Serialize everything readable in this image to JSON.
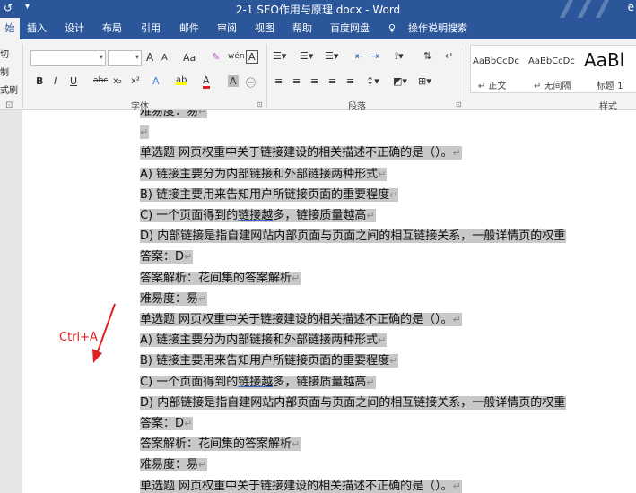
{
  "titlebar": {
    "title": "2-1 SEO作用与原理.docx  -  Word",
    "quick_access": "↺",
    "quick_access_more": "▾",
    "right_char": "e"
  },
  "tabs": [
    {
      "label": "始",
      "active": true
    },
    {
      "label": "插入"
    },
    {
      "label": "设计"
    },
    {
      "label": "布局"
    },
    {
      "label": "引用"
    },
    {
      "label": "邮件"
    },
    {
      "label": "审阅"
    },
    {
      "label": "视图"
    },
    {
      "label": "帮助"
    },
    {
      "label": "百度网盘"
    },
    {
      "label": "操作说明搜索"
    }
  ],
  "ribbon": {
    "clipboard": [
      "切",
      "制",
      "式刷"
    ],
    "font": {
      "group_label": "字体",
      "font_name": "",
      "font_size": "",
      "grow": "A",
      "shrink": "A",
      "case": "Aa",
      "clear": "✎",
      "phonetic": "wén",
      "border_char": "A",
      "bold": "B",
      "italic": "I",
      "underline": "U",
      "strike": "abc",
      "subscript": "x₂",
      "superscript": "x²",
      "effects": "A",
      "highlight": "ab",
      "font_color": "A",
      "shading": "A",
      "enclose": "㊀"
    },
    "paragraph": {
      "group_label": "段落"
    },
    "styles": {
      "group_label": "样式",
      "items": [
        {
          "sample": "AaBbCcDc",
          "name": "↵ 正文"
        },
        {
          "sample": "AaBbCcDc",
          "name": "↵ 无间隔"
        },
        {
          "sample": "AaBl",
          "name": "标题 1"
        }
      ]
    }
  },
  "annotation": {
    "label": "Ctrl+A",
    "color": "#e02020"
  },
  "document": {
    "lines": [
      {
        "text": "难易度：易",
        "pilcrow": "↵"
      },
      {
        "text": "",
        "pilcrow": "↵"
      },
      {
        "text": "单选题   网页权重中关于链接建设的相关描述不正确的是（）。",
        "pilcrow": "↵"
      },
      {
        "text": "A) 链接主要分为内部链接和外部链接两种形式",
        "pilcrow": "↵"
      },
      {
        "text": "B) 链接主要用来告知用户所链接页面的重要程度",
        "pilcrow": "↵"
      },
      {
        "pre": "C) 一个页面得到的",
        "u": "链接越",
        "post": "多，链接质量越高",
        "pilcrow": "↵"
      },
      {
        "text": "D) 内部链接是指自建网站内部页面与页面之间的相互链接关系，一般详情页的权重",
        "pilcrow": ""
      },
      {
        "text": "答案：D",
        "pilcrow": "↵"
      },
      {
        "text": "答案解析：花间集的答案解析",
        "pilcrow": "↵"
      },
      {
        "text": "难易度：易",
        "pilcrow": "↵"
      },
      {
        "text": "单选题   网页权重中关于链接建设的相关描述不正确的是（）。",
        "pilcrow": "↵"
      },
      {
        "text": "A) 链接主要分为内部链接和外部链接两种形式",
        "pilcrow": "↵"
      },
      {
        "text": "B) 链接主要用来告知用户所链接页面的重要程度",
        "pilcrow": "↵"
      },
      {
        "pre": "C) 一个页面得到的",
        "u": "链接越",
        "post": "多，链接质量越高",
        "pilcrow": "↵"
      },
      {
        "text": "D) 内部链接是指自建网站内部页面与页面之间的相互链接关系，一般详情页的权重",
        "pilcrow": ""
      },
      {
        "text": "答案：D",
        "pilcrow": "↵"
      },
      {
        "text": "答案解析：花间集的答案解析",
        "pilcrow": "↵"
      },
      {
        "text": "难易度：易",
        "pilcrow": "↵"
      },
      {
        "text": "单选题   网页权重中关于链接建设的相关描述不正确的是（）。",
        "pilcrow": "↵"
      }
    ]
  }
}
